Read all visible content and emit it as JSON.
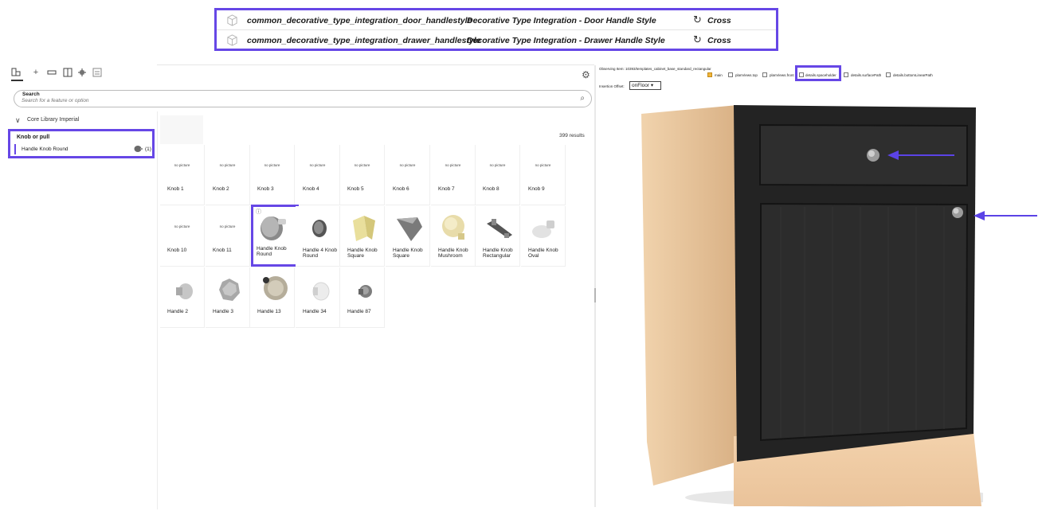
{
  "callout": {
    "rows": [
      {
        "id": "common_decorative_type_integration_door_handlestyle",
        "title": "Decorative Type Integration - Door Handle Style",
        "status": "Cross"
      },
      {
        "id": "common_decorative_type_integration_drawer_handlestyle",
        "title": "Decorative Type Integration - Drawer Handle Style",
        "status": "Cross"
      }
    ]
  },
  "search": {
    "label": "Search",
    "placeholder": "Search for a feature or option"
  },
  "library": {
    "name": "Core Library Imperial"
  },
  "tree": {
    "category": "Knob or pull",
    "item": "Handle Knob Round",
    "count": "(1)"
  },
  "results": "399 results",
  "no_picture": "no picture",
  "tiles_row1": [
    "Knob 1",
    "Knob 2",
    "Knob 3",
    "Knob 4",
    "Knob 5",
    "Knob 6",
    "Knob 7",
    "Knob 8",
    "Knob 9"
  ],
  "tiles_row2": [
    "Knob 10",
    "Knob 11",
    "Handle Knob Round",
    "Handle 4 Knob Round",
    "Handle Knob Square",
    "Handle Knob Square",
    "Handle Knob Mushroom",
    "Handle Knob Rectangular",
    "Handle Knob Oval"
  ],
  "tiles_row3": [
    "Handle 2",
    "Handle 3",
    "Handle 13",
    "Handle 34",
    "Handle 87"
  ],
  "viewer": {
    "observing": "Observing Item: 10393/templates_cabinet_base_standard_rectangular",
    "checkboxes": [
      {
        "label": "main",
        "checked": true
      },
      {
        "label": "planViews.top",
        "checked": false
      },
      {
        "label": "planViews.front",
        "checked": false
      },
      {
        "label": "details.spaceholder",
        "checked": false
      },
      {
        "label": "details.surfacePath",
        "checked": false
      },
      {
        "label": "details.bottomLinearPath",
        "checked": false
      }
    ],
    "insertion_label": "Insertion Offset:",
    "insertion_value": "onFloor"
  },
  "colors": {
    "accent": "#6647e6",
    "cabinet_front": "#262626",
    "cabinet_side": "#e8c49a"
  }
}
